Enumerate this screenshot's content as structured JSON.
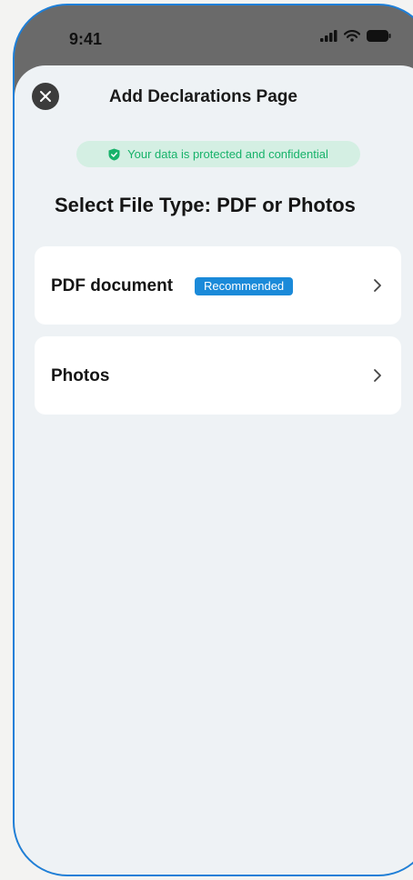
{
  "status_bar": {
    "time": "9:41",
    "icons": [
      "signal-icon",
      "wifi-icon",
      "battery-icon"
    ]
  },
  "header": {
    "title": "Add Declarations Page",
    "close_icon": "close-icon"
  },
  "security_notice": {
    "text": "Your data is protected and confidential",
    "icon": "shield-check-icon",
    "color": "#17b26a"
  },
  "section": {
    "title": "Select File Type: PDF or Photos"
  },
  "options": [
    {
      "label": "PDF document",
      "badge": "Recommended",
      "icon": "chevron-right-icon"
    },
    {
      "label": "Photos",
      "icon": "chevron-right-icon"
    }
  ],
  "colors": {
    "accent": "#1b8ad9",
    "frame": "#1e7fd8",
    "sheet_background": "#eef2f5"
  }
}
